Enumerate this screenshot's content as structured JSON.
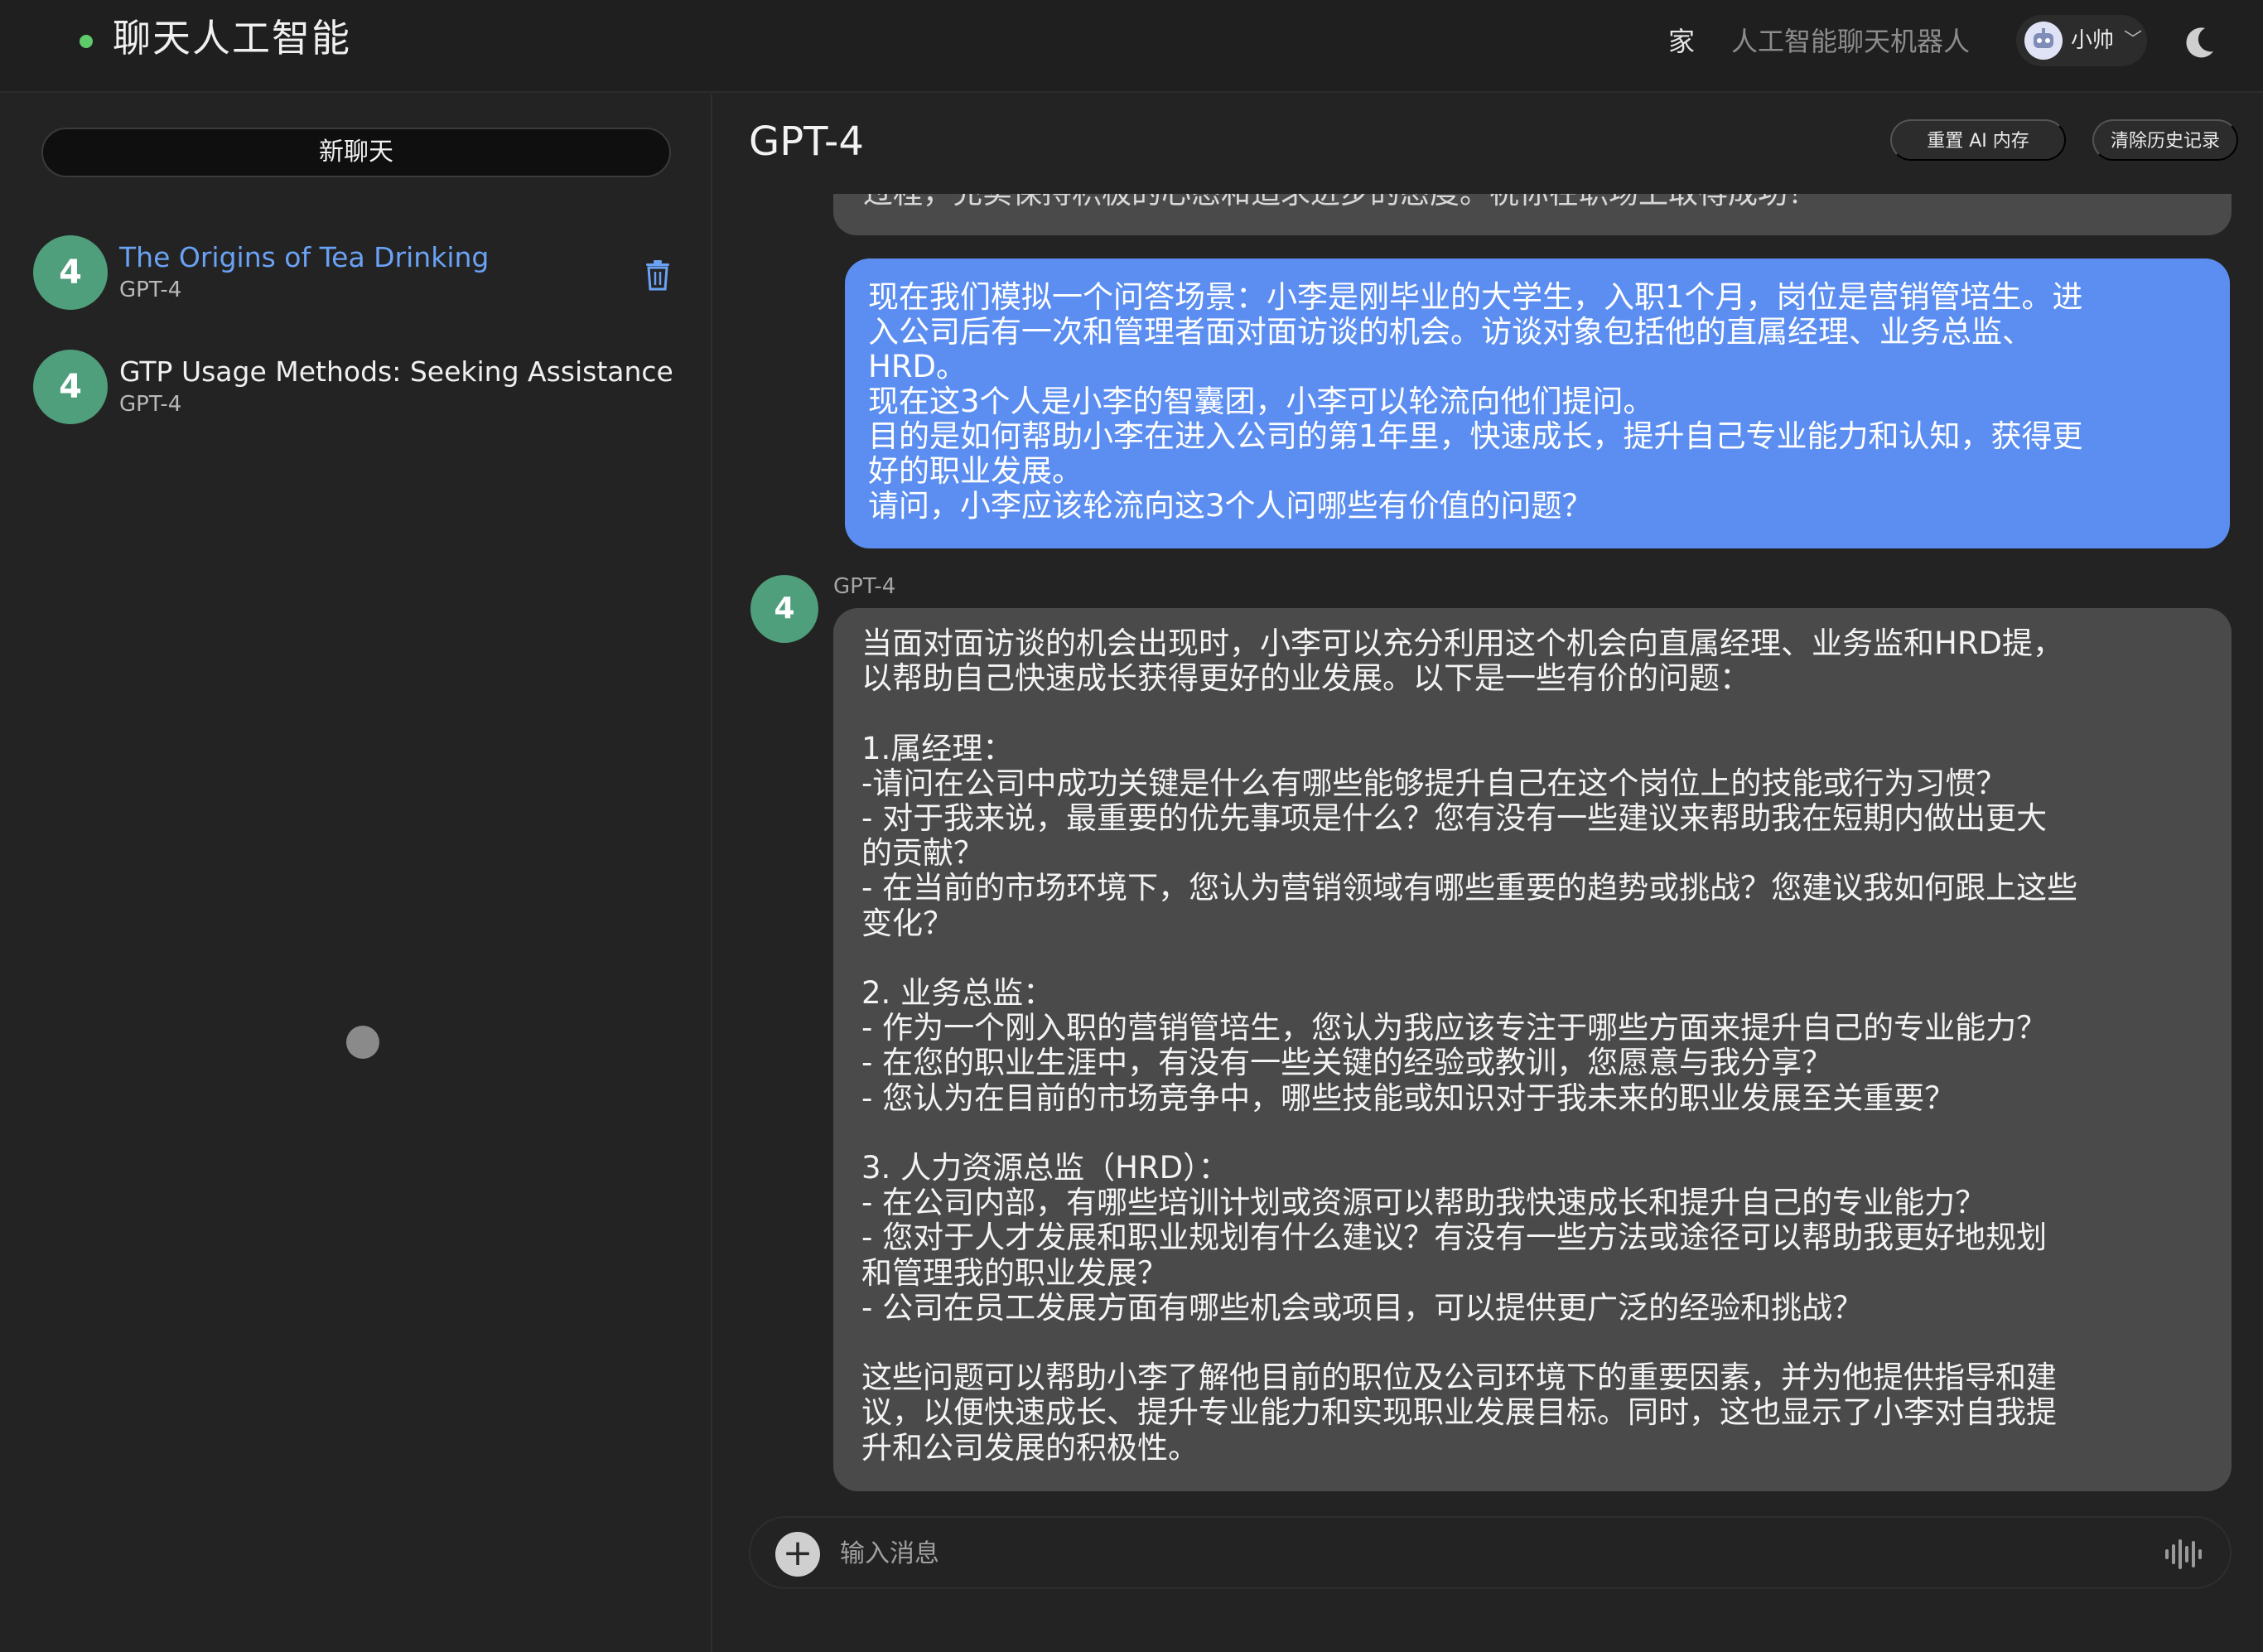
{
  "header": {
    "brand": "聊天人工智能",
    "nav_home": "家",
    "nav_bot": "人工智能聊天机器人",
    "user_name": "小帅",
    "user_chevron": "﹀"
  },
  "sidebar": {
    "new_chat": "新聊天",
    "conversations": [
      {
        "badge": "4",
        "title": "The Origins of Tea Drinking",
        "model": "GPT-4",
        "active": true
      },
      {
        "badge": "4",
        "title": "GTP Usage Methods: Seeking Assistance",
        "model": "GPT-4",
        "active": false
      }
    ]
  },
  "main": {
    "model_title": "GPT-4",
    "reset_button": "重置 AI 内存",
    "clear_button": "清除历史记录",
    "previous_partial": "过程，充实保持积极的心态和追求进步的态度。祝你在职场上取得成功！",
    "user_message": [
      "现在我们模拟一个问答场景：小李是刚毕业的大学生，入职1个月，岗位是营销管培生。进",
      "入公司后有一次和管理者面对面访谈的机会。访谈对象包括他的直属经理、业务总监、",
      "HRD。",
      "现在这3个人是小李的智囊团，小李可以轮流向他们提问。",
      "目的是如何帮助小李在进入公司的第1年里，快速成长，提升自己专业能力和认知，获得更",
      "好的职业发展。",
      "请问，小李应该轮流向这3个人问哪些有价值的问题？"
    ],
    "bot_badge": "4",
    "bot_model": "GPT-4",
    "bot_message": [
      "当面对面访谈的机会出现时，小李可以充分利用这个机会向直属经理、业务监和HRD提，",
      "以帮助自己快速成长获得更好的业发展。以下是一些有价的问题：",
      "",
      "1.属经理：",
      "-请问在公司中成功关键是什么有哪些能够提升自己在这个岗位上的技能或行为习惯？",
      "- 对于我来说，最重要的优先事项是什么？您有没有一些建议来帮助我在短期内做出更大",
      "的贡献？",
      "- 在当前的市场环境下，您认为营销领域有哪些重要的趋势或挑战？您建议我如何跟上这些",
      "变化？",
      "",
      "2. 业务总监：",
      "- 作为一个刚入职的营销管培生，您认为我应该专注于哪些方面来提升自己的专业能力？",
      "- 在您的职业生涯中，有没有一些关键的经验或教训，您愿意与我分享？",
      "- 您认为在目前的市场竞争中，哪些技能或知识对于我未来的职业发展至关重要？",
      "",
      "3. 人力资源总监（HRD）：",
      "- 在公司内部，有哪些培训计划或资源可以帮助我快速成长和提升自己的专业能力？",
      "- 您对于人才发展和职业规划有什么建议？有没有一些方法或途径可以帮助我更好地规划",
      "和管理我的职业发展？",
      "- 公司在员工发展方面有哪些机会或项目，可以提供更广泛的经验和挑战？",
      "",
      "这些问题可以帮助小李了解他目前的职位及公司环境下的重要因素，并为他提供指导和建",
      "议，以便快速成长、提升专业能力和实现职业发展目标。同时，这也显示了小李对自我提",
      "升和公司发展的积极性。"
    ],
    "composer_placeholder": "输入消息"
  },
  "icons": {
    "brand_dot": "status-dot",
    "avatar": "robot-avatar-icon",
    "theme": "moon-icon",
    "delete": "trash-icon",
    "attach": "plus-icon",
    "voice": "voice-wave-icon"
  },
  "colors": {
    "accent_blue": "#5b8ef0",
    "link_blue": "#6aa2f5",
    "badge_green": "#4f9e7c",
    "status_green": "#5ecb6a"
  }
}
